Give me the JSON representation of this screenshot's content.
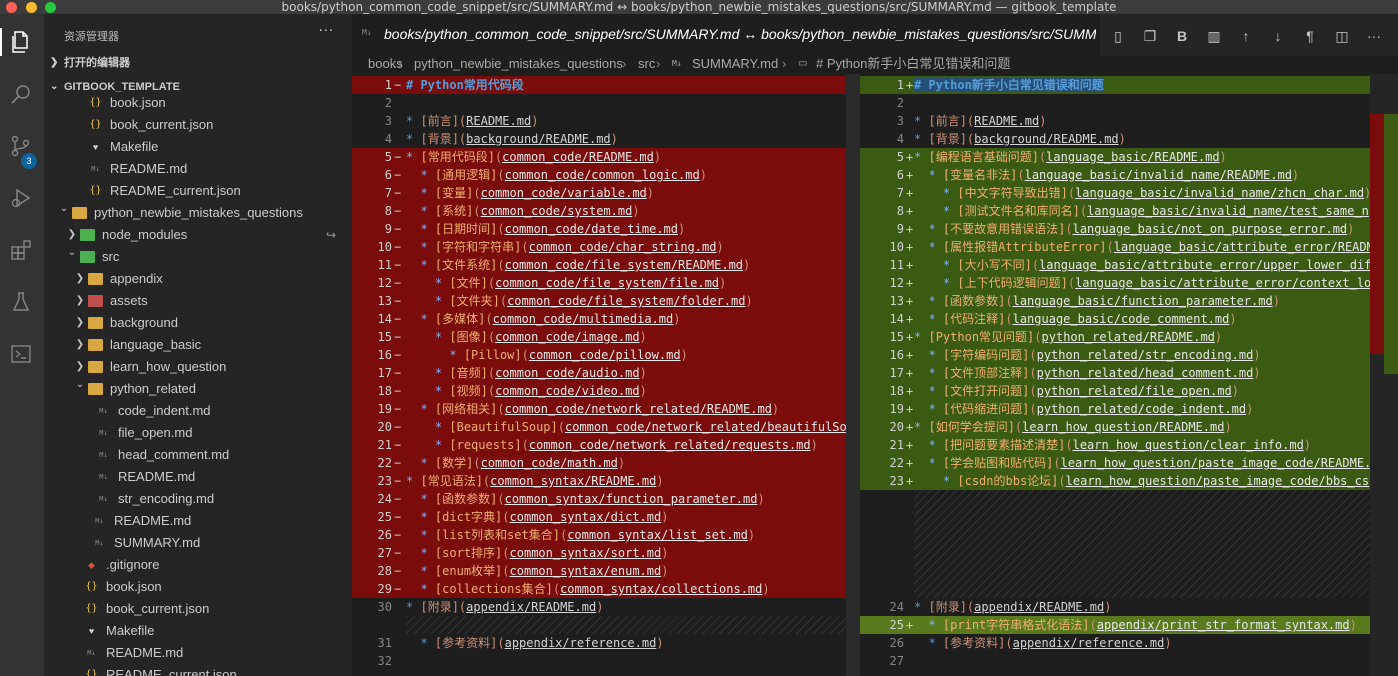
{
  "window": {
    "title": "books/python_common_code_snippet/src/SUMMARY.md ↔ books/python_newbie_mistakes_questions/src/SUMMARY.md — gitbook_template"
  },
  "activity_bar": {
    "scm_badge": "3",
    "icons": [
      "explorer-icon",
      "search-icon",
      "source-control-icon",
      "run-debug-icon",
      "extensions-icon",
      "testing-icon",
      "remote-icon"
    ]
  },
  "sidebar": {
    "header": "资源管理器",
    "more": "···",
    "open_editors": "打开的编辑器",
    "workspace": "GITBOOK_TEMPLATE",
    "items": [
      {
        "label": "book.json",
        "icon": "json",
        "indent": 4
      },
      {
        "label": "book_current.json",
        "icon": "json",
        "indent": 4
      },
      {
        "label": "Makefile",
        "icon": "make",
        "indent": 4
      },
      {
        "label": "README.md",
        "icon": "md",
        "indent": 4
      },
      {
        "label": "README_current.json",
        "icon": "json",
        "indent": 4
      },
      {
        "label": "python_newbie_mistakes_questions",
        "icon": "folder",
        "indent": 2,
        "chev": "v"
      },
      {
        "label": "node_modules",
        "icon": "folder-g",
        "indent": 3,
        "chev": ">",
        "arrow": "↪"
      },
      {
        "label": "src",
        "icon": "folder-g",
        "indent": 3,
        "chev": "v"
      },
      {
        "label": "appendix",
        "icon": "folder",
        "indent": 4,
        "chev": ">"
      },
      {
        "label": "assets",
        "icon": "folder-r",
        "indent": 4,
        "chev": ">"
      },
      {
        "label": "background",
        "icon": "folder",
        "indent": 4,
        "chev": ">"
      },
      {
        "label": "language_basic",
        "icon": "folder",
        "indent": 4,
        "chev": ">"
      },
      {
        "label": "learn_how_question",
        "icon": "folder",
        "indent": 4,
        "chev": ">"
      },
      {
        "label": "python_related",
        "icon": "folder",
        "indent": 4,
        "chev": "v"
      },
      {
        "label": "code_indent.md",
        "icon": "md",
        "indent": 5
      },
      {
        "label": "file_open.md",
        "icon": "md",
        "indent": 5
      },
      {
        "label": "head_comment.md",
        "icon": "md",
        "indent": 5
      },
      {
        "label": "README.md",
        "icon": "md",
        "indent": 5
      },
      {
        "label": "str_encoding.md",
        "icon": "md",
        "indent": 5
      },
      {
        "label": "README.md",
        "icon": "md",
        "indent": 4.5
      },
      {
        "label": "SUMMARY.md",
        "icon": "md",
        "indent": 4.5
      },
      {
        "label": ".gitignore",
        "icon": "git",
        "indent": 3.5
      },
      {
        "label": "book.json",
        "icon": "json",
        "indent": 3.5
      },
      {
        "label": "book_current.json",
        "icon": "json",
        "indent": 3.5
      },
      {
        "label": "Makefile",
        "icon": "make",
        "indent": 3.5
      },
      {
        "label": "README.md",
        "icon": "md",
        "indent": 3.5
      },
      {
        "label": "README_current.json",
        "icon": "json",
        "indent": 3.5
      }
    ]
  },
  "tab": {
    "icon_text": "M↓",
    "label": "books/python_common_code_snippet/src/SUMMARY.md ↔ books/python_newbie_mistakes_questions/src/SUMMARY.md"
  },
  "toolbar": [
    "open-preview-icon",
    "open-file-icon",
    "B",
    "split-preview-icon",
    "↑",
    "↓",
    "¶",
    "split-editor-icon",
    "···"
  ],
  "breadcrumb": [
    "books",
    "python_newbie_mistakes_questions",
    "src",
    "SUMMARY.md",
    "# Python新手小白常见错误和问题"
  ],
  "left_pane": [
    {
      "n": "1",
      "m": "−",
      "t": "del",
      "s": "# Python常用代码段"
    },
    {
      "n": "2",
      "m": "",
      "t": "",
      "s": ""
    },
    {
      "n": "3",
      "m": "",
      "t": "",
      "s": "* [前言](README.md)"
    },
    {
      "n": "4",
      "m": "",
      "t": "",
      "s": "* [背景](background/README.md)"
    },
    {
      "n": "5",
      "m": "−",
      "t": "del",
      "s": "* [常用代码段](common_code/README.md)"
    },
    {
      "n": "6",
      "m": "−",
      "t": "del",
      "s": "  * [通用逻辑](common_code/common_logic.md)"
    },
    {
      "n": "7",
      "m": "−",
      "t": "del",
      "s": "  * [变量](common_code/variable.md)"
    },
    {
      "n": "8",
      "m": "−",
      "t": "del",
      "s": "  * [系统](common_code/system.md)"
    },
    {
      "n": "9",
      "m": "−",
      "t": "del",
      "s": "  * [日期时间](common_code/date_time.md)"
    },
    {
      "n": "10",
      "m": "−",
      "t": "del",
      "s": "  * [字符和字符串](common_code/char_string.md)"
    },
    {
      "n": "11",
      "m": "−",
      "t": "del",
      "s": "  * [文件系统](common_code/file_system/README.md)"
    },
    {
      "n": "12",
      "m": "−",
      "t": "del",
      "s": "    * [文件](common_code/file_system/file.md)"
    },
    {
      "n": "13",
      "m": "−",
      "t": "del",
      "s": "    * [文件夹](common_code/file_system/folder.md)"
    },
    {
      "n": "14",
      "m": "−",
      "t": "del",
      "s": "  * [多媒体](common_code/multimedia.md)"
    },
    {
      "n": "15",
      "m": "−",
      "t": "del",
      "s": "    * [图像](common_code/image.md)"
    },
    {
      "n": "16",
      "m": "−",
      "t": "del",
      "s": "      * [Pillow](common_code/pillow.md)"
    },
    {
      "n": "17",
      "m": "−",
      "t": "del",
      "s": "    * [音频](common_code/audio.md)"
    },
    {
      "n": "18",
      "m": "−",
      "t": "del",
      "s": "    * [视频](common_code/video.md)"
    },
    {
      "n": "19",
      "m": "−",
      "t": "del",
      "s": "  * [网络相关](common_code/network_related/README.md)"
    },
    {
      "n": "20",
      "m": "−",
      "t": "del",
      "s": "    * [BeautifulSoup](common_code/network_related/beautifulSoup"
    },
    {
      "n": "21",
      "m": "−",
      "t": "del",
      "s": "    * [requests](common_code/network_related/requests.md)"
    },
    {
      "n": "22",
      "m": "−",
      "t": "del",
      "s": "  * [数学](common_code/math.md)"
    },
    {
      "n": "23",
      "m": "−",
      "t": "del",
      "s": "* [常见语法](common_syntax/README.md)"
    },
    {
      "n": "24",
      "m": "−",
      "t": "del",
      "s": "  * [函数参数](common_syntax/function_parameter.md)"
    },
    {
      "n": "25",
      "m": "−",
      "t": "del",
      "s": "  * [dict字典](common_syntax/dict.md)"
    },
    {
      "n": "26",
      "m": "−",
      "t": "del",
      "s": "  * [list列表和set集合](common_syntax/list_set.md)"
    },
    {
      "n": "27",
      "m": "−",
      "t": "del",
      "s": "  * [sort排序](common_syntax/sort.md)"
    },
    {
      "n": "28",
      "m": "−",
      "t": "del",
      "s": "  * [enum枚举](common_syntax/enum.md)"
    },
    {
      "n": "29",
      "m": "−",
      "t": "del",
      "s": "  * [collections集合](common_syntax/collections.md)"
    },
    {
      "n": "30",
      "m": "",
      "t": "",
      "s": "* [附录](appendix/README.md)"
    },
    {
      "n": "",
      "m": "",
      "t": "gap",
      "s": ""
    },
    {
      "n": "31",
      "m": "",
      "t": "",
      "s": "  * [参考资料](appendix/reference.md)"
    },
    {
      "n": "32",
      "m": "",
      "t": "",
      "s": ""
    }
  ],
  "right_pane": [
    {
      "n": "1",
      "m": "+",
      "t": "ins",
      "s": "# Python新手小白常见错误和问题"
    },
    {
      "n": "2",
      "m": "",
      "t": "",
      "s": ""
    },
    {
      "n": "3",
      "m": "",
      "t": "",
      "s": "* [前言](README.md)"
    },
    {
      "n": "4",
      "m": "",
      "t": "",
      "s": "* [背景](background/README.md)"
    },
    {
      "n": "5",
      "m": "+",
      "t": "ins",
      "s": "* [编程语言基础问题](language_basic/README.md)"
    },
    {
      "n": "6",
      "m": "+",
      "t": "ins",
      "s": "  * [变量名非法](language_basic/invalid_name/README.md)"
    },
    {
      "n": "7",
      "m": "+",
      "t": "ins",
      "s": "    * [中文字符导致出错](language_basic/invalid_name/zhcn_char.md)"
    },
    {
      "n": "8",
      "m": "+",
      "t": "ins",
      "s": "    * [测试文件名和库同名](language_basic/invalid_name/test_same_n"
    },
    {
      "n": "9",
      "m": "+",
      "t": "ins",
      "s": "  * [不要故意用错误语法](language_basic/not_on_purpose_error.md)"
    },
    {
      "n": "10",
      "m": "+",
      "t": "ins",
      "s": "  * [属性报错AttributeError](language_basic/attribute_error/READM"
    },
    {
      "n": "11",
      "m": "+",
      "t": "ins",
      "s": "    * [大小写不同](language_basic/attribute_error/upper_lower_dif"
    },
    {
      "n": "12",
      "m": "+",
      "t": "ins",
      "s": "    * [上下代码逻辑问题](language_basic/attribute_error/context_lo"
    },
    {
      "n": "13",
      "m": "+",
      "t": "ins",
      "s": "  * [函数参数](language_basic/function_parameter.md)"
    },
    {
      "n": "14",
      "m": "+",
      "t": "ins",
      "s": "  * [代码注释](language_basic/code_comment.md)"
    },
    {
      "n": "15",
      "m": "+",
      "t": "ins",
      "s": "* [Python常见问题](python_related/README.md)"
    },
    {
      "n": "16",
      "m": "+",
      "t": "ins",
      "s": "  * [字符编码问题](python_related/str_encoding.md)"
    },
    {
      "n": "17",
      "m": "+",
      "t": "ins",
      "s": "  * [文件顶部注释](python_related/head_comment.md)"
    },
    {
      "n": "18",
      "m": "+",
      "t": "ins",
      "s": "  * [文件打开问题](python_related/file_open.md)"
    },
    {
      "n": "19",
      "m": "+",
      "t": "ins",
      "s": "  * [代码缩进问题](python_related/code_indent.md)"
    },
    {
      "n": "20",
      "m": "+",
      "t": "ins",
      "s": "* [如何学会提问](learn_how_question/README.md)"
    },
    {
      "n": "21",
      "m": "+",
      "t": "ins",
      "s": "  * [把问题要素描述清楚](learn_how_question/clear_info.md)"
    },
    {
      "n": "22",
      "m": "+",
      "t": "ins",
      "s": "  * [学会贴图和贴代码](learn_how_question/paste_image_code/README."
    },
    {
      "n": "23",
      "m": "+",
      "t": "ins",
      "s": "    * [csdn的bbs论坛](learn_how_question/paste_image_code/bbs_cs"
    },
    {
      "n": "",
      "m": "",
      "t": "gap6",
      "s": ""
    },
    {
      "n": "24",
      "m": "",
      "t": "",
      "s": "* [附录](appendix/README.md)"
    },
    {
      "n": "25",
      "m": "+",
      "t": "ins",
      "s": "  * [print字符串格式化语法](appendix/print_str_format_syntax.md)"
    },
    {
      "n": "26",
      "m": "",
      "t": "",
      "s": "  * [参考资料](appendix/reference.md)"
    },
    {
      "n": "27",
      "m": "",
      "t": "",
      "s": ""
    }
  ],
  "colors": {
    "deleted_bg": "#7a0c0c",
    "inserted_bg": "#3b5a12",
    "accent": "#0e639c"
  }
}
